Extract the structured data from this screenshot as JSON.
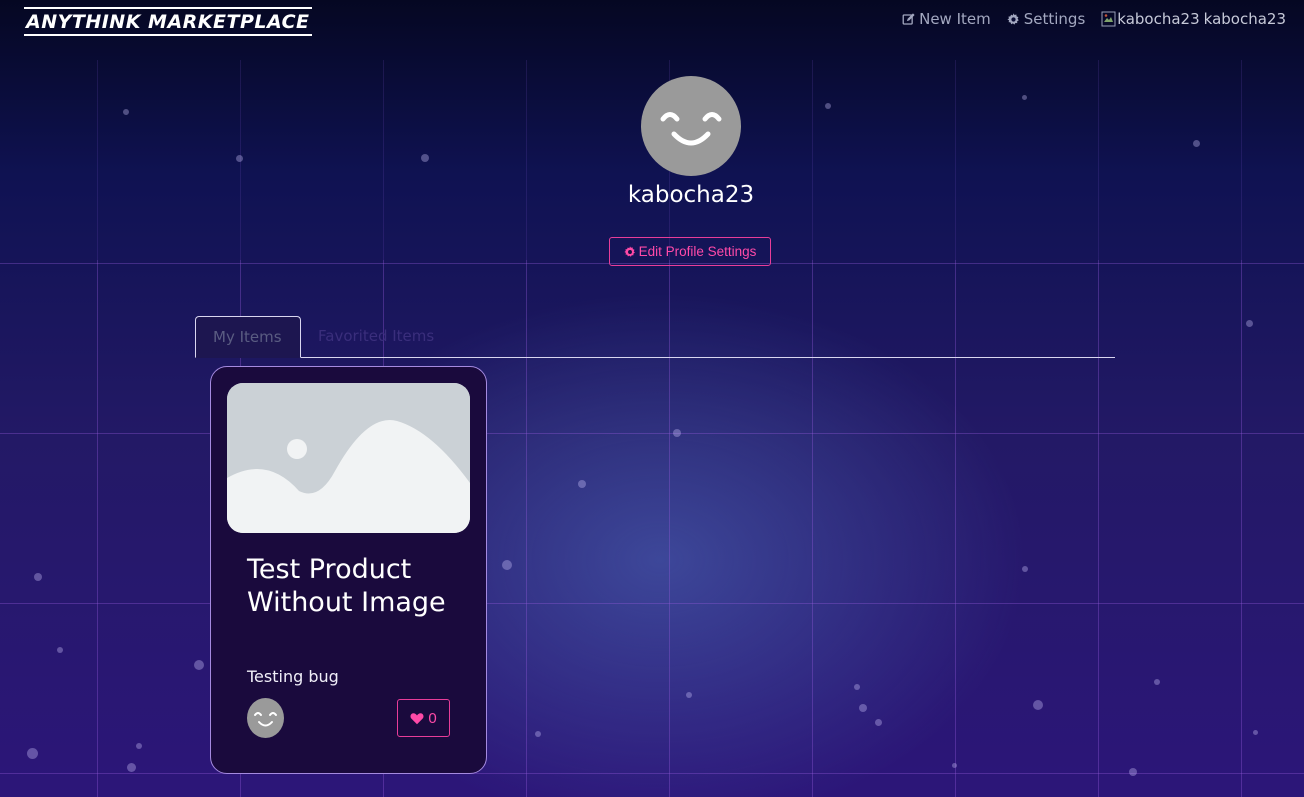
{
  "navbar": {
    "brand": "ANYTHINK MARKETPLACE",
    "new_item_label": "New Item",
    "settings_label": "Settings",
    "user_image_alt": "kabocha23",
    "username": "kabocha23"
  },
  "profile": {
    "username": "kabocha23",
    "edit_button_label": "Edit Profile Settings"
  },
  "tabs": [
    {
      "label": "My Items",
      "active": true
    },
    {
      "label": "Favorited Items",
      "active": false
    }
  ],
  "items": [
    {
      "title": "Test Product Without Image",
      "description": "Testing bug",
      "favorites_count": "0"
    }
  ],
  "colors": {
    "accent": "#ff4aa8",
    "background_top": "#050722",
    "background_bottom": "#2c1679",
    "card_background": "#1a0a3d",
    "card_border": "#a58ae0"
  },
  "icons": {
    "new_item": "edit-icon",
    "settings": "gear-icon",
    "edit_profile": "gear-icon",
    "favorite": "heart-icon",
    "broken_image": "broken-image-icon",
    "placeholder": "image-placeholder-icon",
    "avatar": "smiley-avatar-icon"
  }
}
